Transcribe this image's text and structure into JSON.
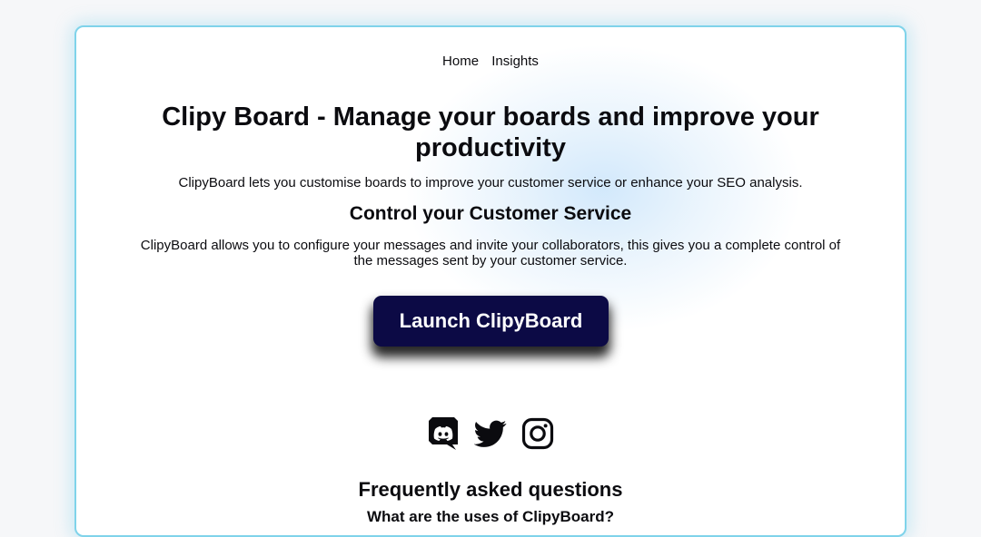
{
  "nav": {
    "home_label": "Home",
    "insights_label": "Insights"
  },
  "hero": {
    "title": "Clipy Board - Manage your boards and improve your productivity",
    "subtitle": "ClipyBoard lets you customise boards to improve your customer service or enhance your SEO analysis."
  },
  "section": {
    "title": "Control your Customer Service",
    "text": "ClipyBoard allows you to configure your messages and invite your collaborators, this gives you a complete control of the messages sent by your customer service."
  },
  "cta": {
    "label": "Launch ClipyBoard"
  },
  "socials": [
    "discord-icon",
    "twitter-icon",
    "instagram-icon"
  ],
  "faq": {
    "title": "Frequently asked questions",
    "first_question": "What are the uses of ClipyBoard?"
  },
  "colors": {
    "frame_border": "#7fd3ea",
    "cta_background": "#0c0a45",
    "cta_text": "#ffffff",
    "text": "#0b0b0f"
  }
}
